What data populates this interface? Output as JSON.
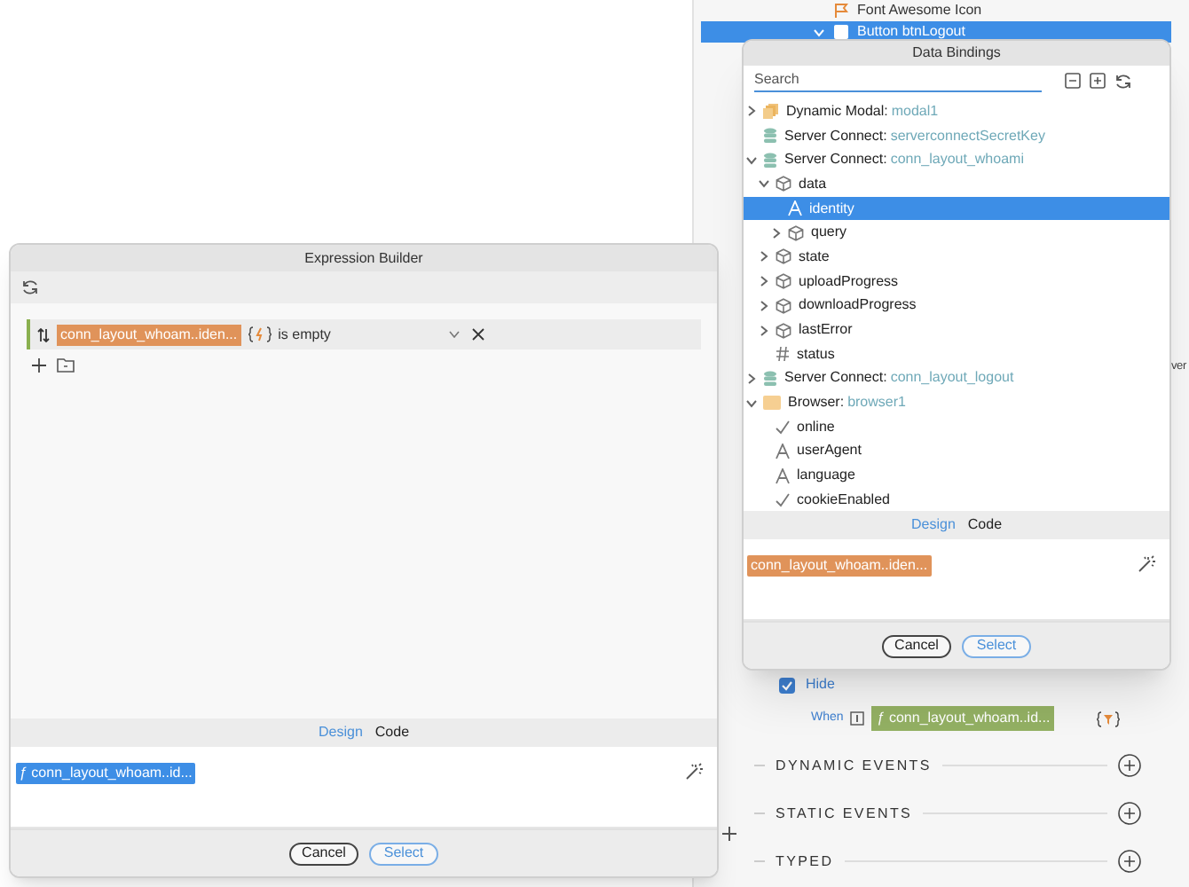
{
  "background_tree": [
    {
      "label": "Font Awesome Icon",
      "kind": "flag",
      "selected": false
    },
    {
      "label": "Button btnLogout",
      "kind": "button",
      "expanded": true,
      "selected": true
    }
  ],
  "side_fragment": "ver",
  "expression_builder": {
    "title": "Expression Builder",
    "condition": {
      "token": "conn_layout_whoam..iden...",
      "operator": "is empty"
    },
    "tabs": [
      {
        "label": "Design",
        "selected": true
      },
      {
        "label": "Code",
        "selected": false
      }
    ],
    "expression": {
      "token": "ƒ conn_layout_whoam..id...",
      "selected": true
    },
    "buttons": [
      {
        "label": "Cancel",
        "kind": "cancel"
      },
      {
        "label": "Select",
        "kind": "primary"
      }
    ]
  },
  "data_bindings": {
    "title": "Data Bindings",
    "search": {
      "placeholder": "Search"
    },
    "tree": [
      {
        "label": "Dynamic Modal:",
        "value": "modal1",
        "kind": "modal",
        "expanded": false,
        "selected": false
      },
      {
        "label": "Server Connect:",
        "value": "serverconnectSecretKey",
        "kind": "database",
        "selected": false
      },
      {
        "label": "Server Connect:",
        "value": "conn_layout_whoami",
        "kind": "database",
        "expanded": true,
        "selected": false,
        "children": [
          {
            "label": "data",
            "kind": "object",
            "expanded": true,
            "selected": false,
            "children": [
              {
                "label": "identity",
                "kind": "text",
                "selected": true
              },
              {
                "label": "query",
                "kind": "object",
                "expanded": false,
                "selected": false
              }
            ]
          },
          {
            "label": "state",
            "kind": "object",
            "expanded": false,
            "selected": false
          },
          {
            "label": "uploadProgress",
            "kind": "object",
            "expanded": false,
            "selected": false
          },
          {
            "label": "downloadProgress",
            "kind": "object",
            "expanded": false,
            "selected": false
          },
          {
            "label": "lastError",
            "kind": "object",
            "expanded": false,
            "selected": false
          },
          {
            "label": "status",
            "kind": "number",
            "selected": false
          }
        ]
      },
      {
        "label": "Server Connect:",
        "value": "conn_layout_logout",
        "kind": "database",
        "expanded": false,
        "selected": false
      },
      {
        "label": "Browser:",
        "value": "browser1",
        "kind": "folder",
        "expanded": true,
        "selected": false,
        "children": [
          {
            "label": "online",
            "kind": "boolean",
            "selected": false
          },
          {
            "label": "userAgent",
            "kind": "text",
            "selected": false
          },
          {
            "label": "language",
            "kind": "text",
            "selected": false
          },
          {
            "label": "cookieEnabled",
            "kind": "boolean",
            "selected": false
          }
        ]
      }
    ],
    "tabs": [
      {
        "label": "Design",
        "selected": true
      },
      {
        "label": "Code",
        "selected": false
      }
    ],
    "expression": {
      "token": "conn_layout_whoam..iden...",
      "selected": false
    },
    "buttons": [
      {
        "label": "Cancel",
        "kind": "cancel"
      },
      {
        "label": "Select",
        "kind": "primary"
      }
    ]
  },
  "properties": {
    "hide": {
      "label": "Hide",
      "checked": true
    },
    "when": {
      "label": "When",
      "token": "ƒ conn_layout_whoam..id..."
    },
    "sections": [
      {
        "label": "DYNAMIC EVENTS"
      },
      {
        "label": "STATIC EVENTS"
      },
      {
        "label": "TYPED"
      }
    ]
  }
}
